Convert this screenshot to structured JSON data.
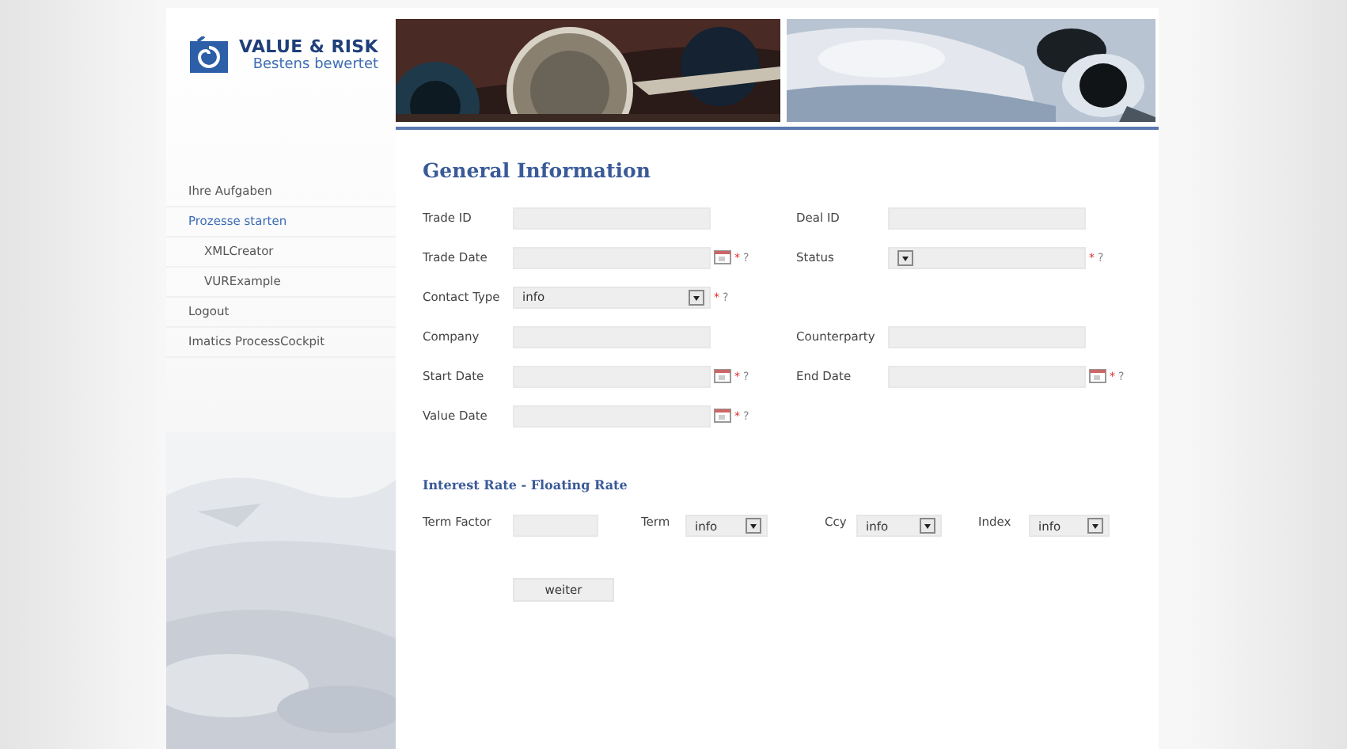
{
  "logo": {
    "name": "VALUE & RISK",
    "tagline": "Bestens bewertet"
  },
  "sidebar": {
    "items": [
      {
        "label": "Ihre Aufgaben",
        "selected": false
      },
      {
        "label": "Prozesse starten",
        "selected": true,
        "children": [
          {
            "label": "XMLCreator",
            "selected": false
          },
          {
            "label": "VURExample",
            "selected": false
          }
        ]
      },
      {
        "label": "Logout",
        "selected": false
      },
      {
        "label": "Imatics ProcessCockpit",
        "selected": false
      }
    ]
  },
  "general": {
    "title": "General Information",
    "rows": [
      [
        {
          "label": "Trade ID",
          "kind": "text"
        },
        {
          "label": "Deal ID",
          "kind": "text"
        }
      ],
      [
        {
          "label": "Trade Date",
          "kind": "date",
          "required_mark": "*",
          "help": "?"
        },
        {
          "label": "Status",
          "kind": "select",
          "required_mark": "*",
          "help": "?"
        }
      ],
      [
        {
          "label": "Contact Type",
          "kind": "select",
          "value": "info",
          "required_mark": "*",
          "help": "?"
        }
      ],
      [
        {
          "label": "Company",
          "kind": "text"
        },
        {
          "label": "Counterparty",
          "kind": "text"
        }
      ],
      [
        {
          "label": "Start Date",
          "kind": "date",
          "required_mark": "*",
          "help": "?"
        },
        {
          "label": "End Date",
          "kind": "date",
          "required_mark": "*",
          "help": "?"
        }
      ],
      [
        {
          "label": "Value Date",
          "kind": "date",
          "required_mark": "*",
          "help": "?"
        }
      ]
    ]
  },
  "interest": {
    "title": "Interest Rate - Floating Rate",
    "fields": [
      {
        "label": "Term Factor",
        "kind": "text"
      },
      {
        "label": "Term",
        "kind": "select",
        "value": "info"
      },
      {
        "label": "Ccy",
        "kind": "select",
        "value": "info"
      },
      {
        "label": "Index",
        "kind": "select",
        "value": "info"
      }
    ]
  },
  "buttons": [
    "weiter"
  ]
}
